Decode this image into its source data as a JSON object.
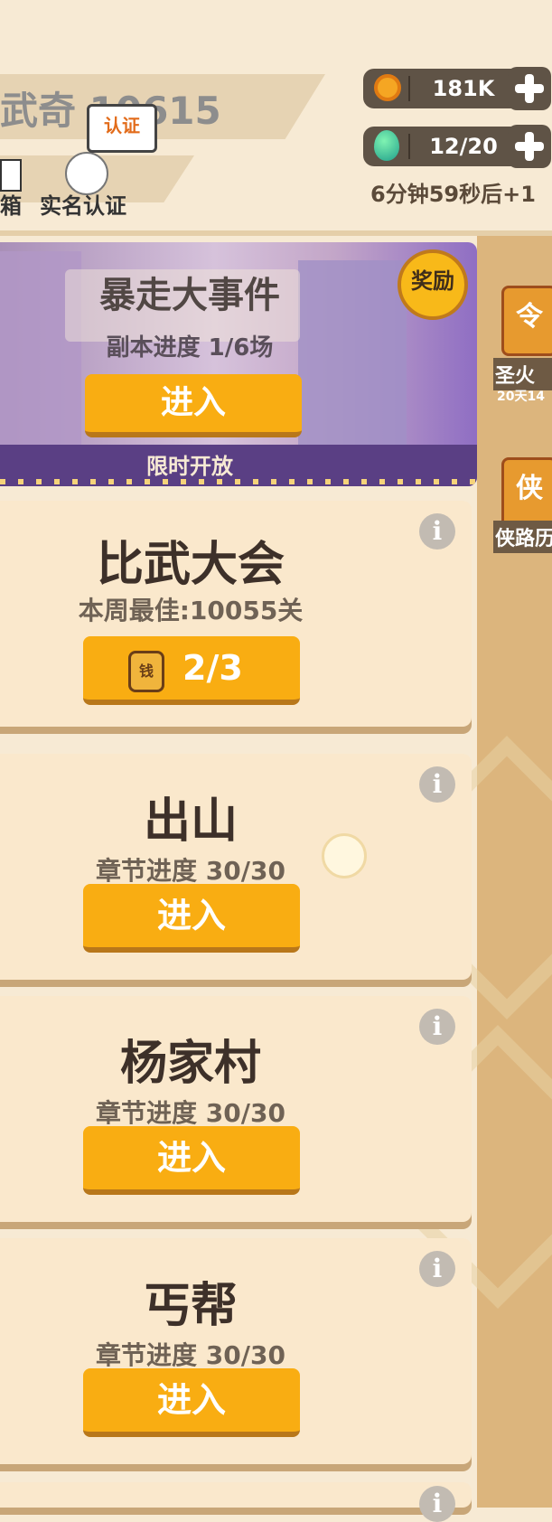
{
  "player": {
    "name": "武奇 10615",
    "mail_label": "箱",
    "verify_label": "实名认证",
    "verify_tooltip": "认证"
  },
  "resources": {
    "coins": "181K",
    "energy": "12/20",
    "timer": "6分钟59秒后+1"
  },
  "event": {
    "title": "暴走大事件",
    "progress": "副本进度 1/6场",
    "button": "进入",
    "footer": "限时开放",
    "reward_badge": "奖励"
  },
  "arena": {
    "title": "比武大会",
    "best": "本周最佳:10055关",
    "tickets": "2/3",
    "ticket_icon_text": "钱"
  },
  "stages": [
    {
      "title": "出山",
      "progress": "章节进度 30/30",
      "button": "进入"
    },
    {
      "title": "杨家村",
      "progress": "章节进度 30/30",
      "button": "进入"
    },
    {
      "title": "丐帮",
      "progress": "章节进度 30/30",
      "button": "进入"
    }
  ],
  "sidebar": {
    "fire_icon_text": "令",
    "fire_label": "圣火",
    "fire_timer": "20天14",
    "history_icon_text": "侠",
    "history_label": "侠路历"
  },
  "icons": {
    "info": "info-icon",
    "plus": "plus-icon",
    "coin": "coin-icon",
    "gem": "gem-icon",
    "mail": "mail-icon",
    "verify": "verify-icon"
  },
  "colors": {
    "accent_button": "#f9ad12",
    "background": "#f7ead4",
    "card": "#fae8cc",
    "resource_pill": "#5f5346"
  }
}
